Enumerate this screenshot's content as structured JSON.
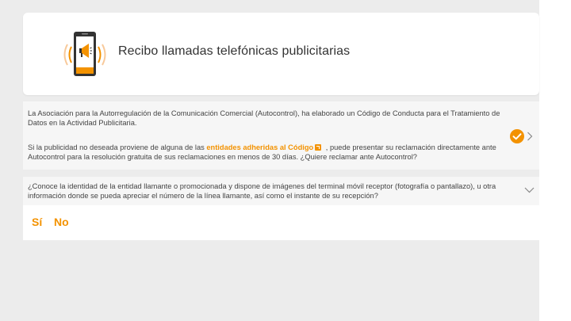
{
  "header": {
    "title": "Recibo llamadas telefónicas publicitarias",
    "icon": "phone-megaphone-icon"
  },
  "info": {
    "paragraph1": "La Asociación para la Autorregulación de la Comunicación Comercial (Autocontrol), ha elaborado un Código de Conducta para el Tratamiento de Datos en la Actividad Publicitaria.",
    "paragraph2_before": "Si la publicidad no deseada proviene de alguna de las ",
    "link_text": "entidades adheridas al Código",
    "paragraph2_after": " , puede presentar su reclamación directamente ante Autocontrol para la resolución gratuita de sus reclamaciones en menos de 30 días. ¿Quiere reclamar ante Autocontrol?",
    "status_icon": "check-circle-icon"
  },
  "question": {
    "text": "¿Conoce la identidad de la entidad llamante o promocionada y dispone de imágenes del terminal móvil receptor (fotografía o pantallazo), u otra información donde se pueda apreciar el número de la línea llamante, así como el instante de su recepción?"
  },
  "answers": {
    "yes": "Sí",
    "no": "No"
  },
  "colors": {
    "accent": "#f39200",
    "background": "#ececec",
    "card": "#f6f6f6"
  }
}
